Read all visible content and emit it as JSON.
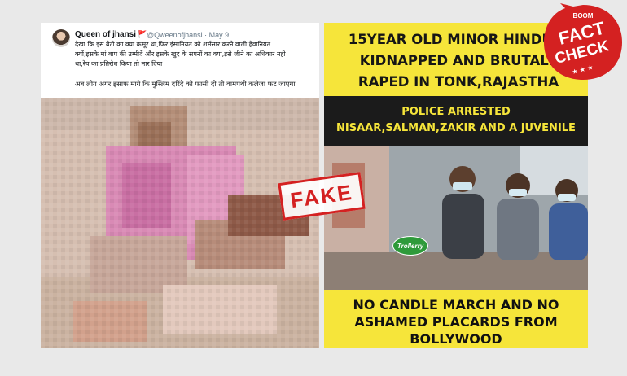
{
  "tweet": {
    "user_name": "Queen of jhansi",
    "flag_glyph": "🚩",
    "handle_line": "@Qweenofjhansi · May 9",
    "text_lines": [
      "देखा कि इस बेटी का क्या कसूर था,फिर इंसानियत को शर्मसार करने वाली हैवानियत",
      "क्यों,इसके मां बाप की उम्मीदें और इसके खुद के सपनों का क्या,इसे जीने का अधिकार नही",
      "था,रेप का प्रतिरोध किया तो मार दिया"
    ],
    "second_text": "अब लोग अगर इंसाफ मांगे कि मुस्लिम दरिंदे को फासी दो तो वामपंथी कलेजा फट जाएगा"
  },
  "right_panel": {
    "headline_lines": [
      "15YEAR OLD MINOR HINDU G",
      "KIDNAPPED AND BRUTALL",
      "RAPED IN TONK,RAJASTHA"
    ],
    "band_lines": [
      "POLICE ARRESTED",
      "NISAAR,SALMAN,ZAKIR AND A JUVENILE"
    ],
    "watermark": "Trollerry",
    "bottom_lines": [
      "NO CANDLE MARCH AND NO",
      "ASHAMED PLACARDS FROM",
      "BOLLYWOOD"
    ]
  },
  "stamp": {
    "label": "FAKE"
  },
  "badge": {
    "brand": "BOOM",
    "line1": "FACT",
    "line2": "CHECK",
    "stars": "★ ★ ★"
  },
  "colors": {
    "background": "#e9e9e9",
    "panel_yellow": "#f6e53a",
    "band_black": "#1b1b1b",
    "stamp_red": "#d42121",
    "badge_red": "#d42121"
  }
}
